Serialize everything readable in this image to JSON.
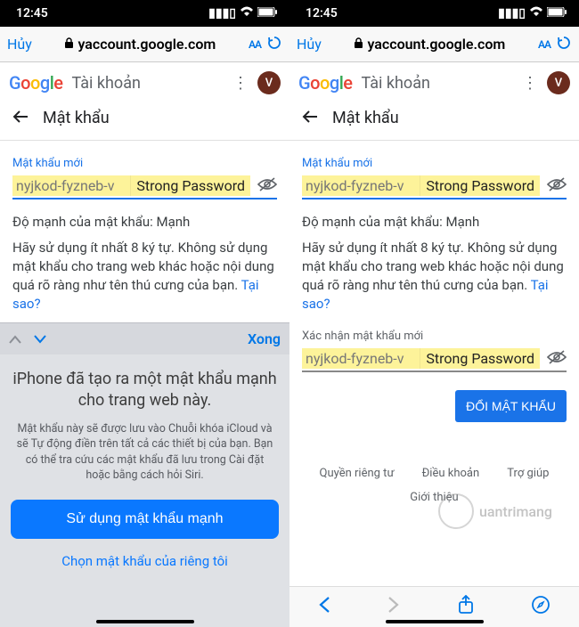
{
  "status": {
    "time": "12:45"
  },
  "browser": {
    "cancel": "Hủy",
    "url": "yaccount.google.com",
    "aa": "AA"
  },
  "header": {
    "account_label": "Tài khoản",
    "avatar_initial": "V"
  },
  "page": {
    "back": "←",
    "title": "Mật khẩu",
    "new_pw_label": "Mật khẩu mới",
    "pw_value": "nyjkod-fyzneb-v",
    "strong_tag": "Strong Password",
    "strength": "Độ mạnh của mật khẩu: Mạnh",
    "help": "Hãy sử dụng ít nhất 8 ký tự. Không sử dụng mật khẩu cho trang web khác hoặc nội dung quá rõ ràng như tên thú cưng của bạn. ",
    "why": "Tại sao?",
    "confirm_label": "Xác nhận mật khẩu mới",
    "change_btn": "ĐỔI MẬT KHẨU",
    "footer": {
      "privacy": "Quyền riêng tư",
      "terms": "Điều khoản",
      "help": "Trợ giúp",
      "intro": "Giới thiệu"
    }
  },
  "keyboard": {
    "done": "Xong",
    "panel_title": "iPhone đã tạo ra một mật khẩu mạnh cho trang web này.",
    "panel_desc": "Mật khẩu này sẽ được lưu vào Chuỗi khóa iCloud và sẽ Tự động điền trên tất cả các thiết bị của bạn. Bạn có thể tra cứu các mật khẩu đã lưu trong Cài đặt hoặc bằng cách hỏi Siri.",
    "use_strong": "Sử dụng mật khẩu mạnh",
    "own_pw": "Chọn mật khẩu của riêng tôi"
  },
  "watermark": "uantrimang"
}
